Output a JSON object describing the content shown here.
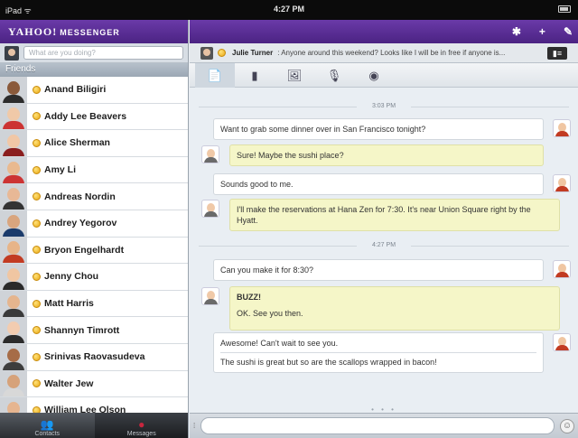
{
  "status_bar": {
    "device": "iPad ᯤ",
    "time": "4:27 PM"
  },
  "app": {
    "logo": "YAHOO!",
    "logo_sub": "MESSENGER"
  },
  "left": {
    "status_placeholder": "What are you doing?",
    "group": "Friends",
    "contacts": [
      {
        "name": "Anand Biligiri",
        "skin": "#8a5a3b",
        "shirt": "#2c2c2c"
      },
      {
        "name": "Addy Lee Beavers",
        "skin": "#f0c9a8",
        "shirt": "#c33"
      },
      {
        "name": "Alice Sherman",
        "skin": "#f1c7a6",
        "shirt": "#8a1e1e"
      },
      {
        "name": "Amy Li",
        "skin": "#e9b98f",
        "shirt": "#c33"
      },
      {
        "name": "Andreas Nordin",
        "skin": "#e8b896",
        "shirt": "#333"
      },
      {
        "name": "Andrey Yegorov",
        "skin": "#d9a57e",
        "shirt": "#1b3b6b"
      },
      {
        "name": "Bryon Engelhardt",
        "skin": "#e7b488",
        "shirt": "#c23b22"
      },
      {
        "name": "Jenny Chou",
        "skin": "#f0c6a2",
        "shirt": "#2a2a2a"
      },
      {
        "name": "Matt Harris",
        "skin": "#e5b58e",
        "shirt": "#3a3a3a"
      },
      {
        "name": "Shannyn Timrott",
        "skin": "#f2ccb0",
        "shirt": "#2b2b2b"
      },
      {
        "name": "Srinivas Raovasudeva",
        "skin": "#a66c47",
        "shirt": "#3d3d3d"
      },
      {
        "name": "Walter Jew",
        "skin": "#d6a27a",
        "shirt": "#d8d8d8"
      },
      {
        "name": "William Lee Olson",
        "skin": "#e6b590",
        "shirt": "#9a2c2c"
      }
    ],
    "tabs": [
      {
        "label": "Contacts",
        "icon": "people-icon"
      },
      {
        "label": "Messages",
        "icon": "messages-icon"
      }
    ]
  },
  "right": {
    "header_icons": {
      "settings": "✱",
      "add": "+",
      "compose": "✎"
    },
    "conversation": {
      "buddy": "Julie Turner",
      "preview": ": Anyone around this weekend? Looks like I will be in free if anyone is...",
      "profile_icon": "▮≡"
    },
    "tools": [
      "📄",
      "▮",
      "🖼",
      "🎙",
      "◉"
    ],
    "timestamps": [
      "3:03 PM",
      "4:27 PM"
    ],
    "messages": [
      {
        "from": "me",
        "text": "Want to grab some dinner over in San Francisco tonight?"
      },
      {
        "from": "them",
        "text": "Sure! Maybe the sushi place?"
      },
      {
        "from": "me",
        "text": "Sounds good to me."
      },
      {
        "from": "them",
        "text": "I'll make the reservations at Hana Zen for 7:30. It's near Union Square right by the Hyatt."
      },
      {
        "from": "me",
        "text": "Can you make it for 8:30?"
      },
      {
        "from": "them",
        "buzz": "BUZZ!",
        "text": "OK. See you then."
      },
      {
        "from": "me",
        "text": "Awesome! Can't wait to see you.",
        "text2": "The sushi is great but so are the scallops wrapped in bacon!"
      }
    ],
    "page_dots": "• • •",
    "input": {
      "placeholder": ""
    }
  },
  "colors": {
    "brand": "#5a2c95",
    "buddy_bubble": "#f5f6c8",
    "presence": "#e9a712"
  }
}
